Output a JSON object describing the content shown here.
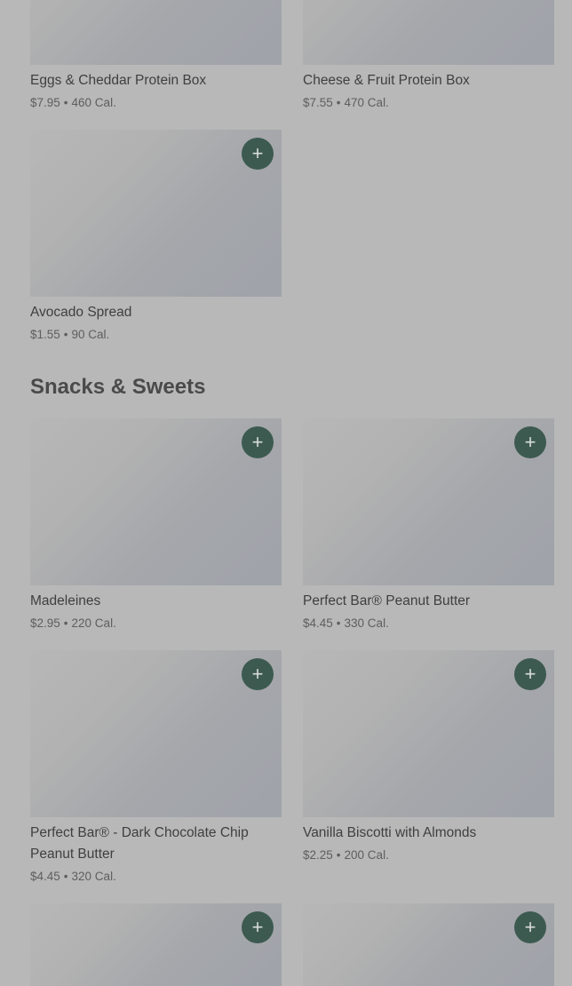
{
  "colors": {
    "overlay_bg": "#b8b8b8",
    "add_button": "#3d5a50",
    "title": "#4a4a4a"
  },
  "icons": {
    "add": "plus-icon"
  },
  "items_top": [
    {
      "name": "Eggs & Cheddar Protein Box",
      "price": "$7.95",
      "calories": "460 Cal."
    },
    {
      "name": "Cheese & Fruit Protein Box",
      "price": "$7.55",
      "calories": "470 Cal."
    },
    {
      "name": "Avocado Spread",
      "price": "$1.55",
      "calories": "90 Cal."
    }
  ],
  "section": {
    "title": "Snacks & Sweets"
  },
  "items_snacks": [
    {
      "name": "Madeleines",
      "price": "$2.95",
      "calories": "220 Cal."
    },
    {
      "name": "Perfect Bar® Peanut Butter",
      "price": "$4.45",
      "calories": "330 Cal."
    },
    {
      "name": "Perfect Bar® - Dark Chocolate Chip Peanut Butter",
      "price": "$4.45",
      "calories": "320 Cal."
    },
    {
      "name": "Vanilla Biscotti with Almonds",
      "price": "$2.25",
      "calories": "200 Cal."
    }
  ]
}
